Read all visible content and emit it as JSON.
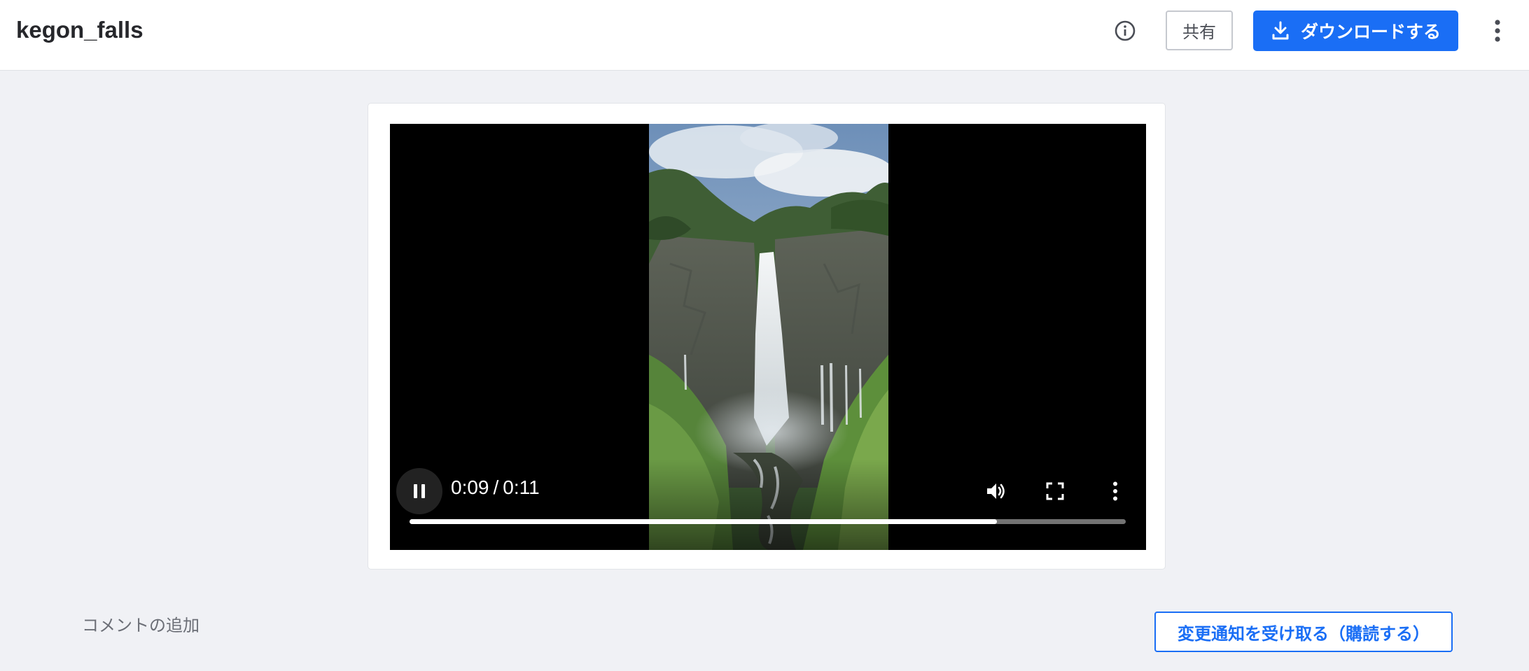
{
  "header": {
    "title": "kegon_falls",
    "share_label": "共有",
    "download_label": "ダウンロードする",
    "icons": {
      "info": "info-circle-icon",
      "download": "download-icon",
      "more": "more-vertical-icon"
    }
  },
  "player": {
    "current_time": "0:09",
    "separator": "/",
    "duration": "0:11",
    "progress_fraction": 0.82,
    "icons": {
      "pause": "pause-icon",
      "volume": "volume-icon",
      "fullscreen": "fullscreen-icon",
      "more": "more-vertical-icon"
    }
  },
  "footer": {
    "comment_label": "コメントの追加",
    "subscribe_label": "変更通知を受け取る（購読する）"
  },
  "colors": {
    "accent": "#1a6ef5",
    "background": "#f0f1f5"
  }
}
